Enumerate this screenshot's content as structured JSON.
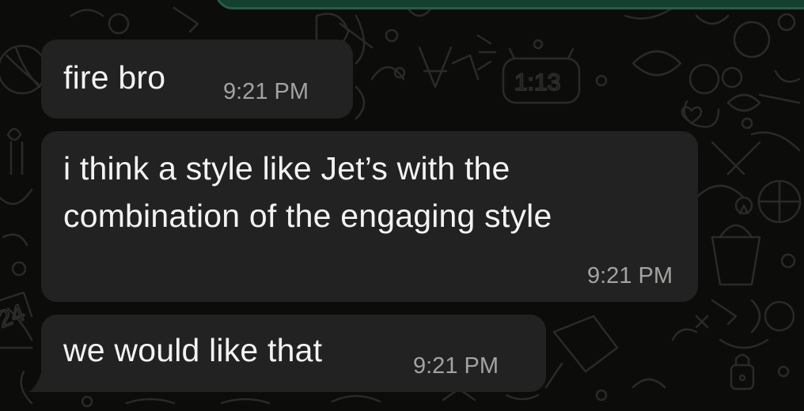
{
  "messages": [
    {
      "text": "fire bro",
      "time": "9:21 PM"
    },
    {
      "text_lines": [
        "i think a style like Jet’s with the",
        "combination of the engaging style"
      ],
      "time": "9:21 PM"
    },
    {
      "text": "we would like that",
      "time": "9:21 PM"
    }
  ],
  "wallpaper_doodles": [
    "1:13",
    "24"
  ],
  "colors": {
    "background": "#0c0c0b",
    "incoming_bubble": "#212221",
    "outgoing_bubble": "#14402f",
    "message_text": "#f3f3f3",
    "timestamp_text": "#a3a3a1",
    "doodle_stroke": "#2a2a28"
  }
}
